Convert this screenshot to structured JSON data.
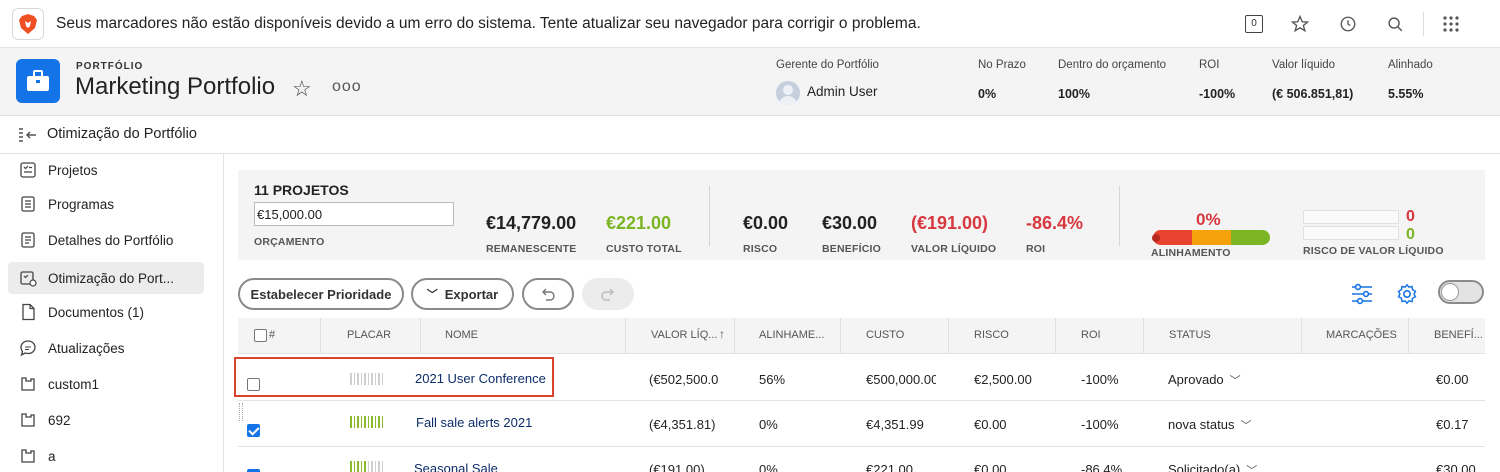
{
  "banner": {
    "message": "Seus marcadores não estão disponíveis devido a um erro do sistema. Tente atualizar seu navegador para corrigir o problema.",
    "badge_count": "0",
    "icons": [
      "brave-lion-icon",
      "tab-counter-icon",
      "star-icon",
      "history-icon",
      "search-icon",
      "grid-icon"
    ]
  },
  "portfolio": {
    "eyebrow": "PORTFÓLIO",
    "title": "Marketing Portfolio",
    "more": "ooo",
    "stats": {
      "manager_label": "Gerente do Portfólio",
      "manager_name": "Admin User",
      "on_time_label": "No Prazo",
      "on_time_value": "0%",
      "budget_label": "Dentro do orçamento",
      "budget_value": "100%",
      "roi_label": "ROI",
      "roi_value": "-100%",
      "net_label": "Valor líquido",
      "net_value": "(€ 506.851,81)",
      "aligned_label": "Alinhado",
      "aligned_value": "5.55%"
    }
  },
  "subheader": {
    "title": "Otimização do Portfólio"
  },
  "sidebar": {
    "items": [
      {
        "label": "Projetos",
        "icon": "projects-icon"
      },
      {
        "label": "Programas",
        "icon": "programs-icon"
      },
      {
        "label": "Detalhes do Portfólio",
        "icon": "details-icon"
      },
      {
        "label": "Otimização do Port...",
        "icon": "optimizer-icon",
        "active": true
      },
      {
        "label": "Documentos (1)",
        "icon": "documents-icon"
      },
      {
        "label": "Atualizações",
        "icon": "updates-icon"
      },
      {
        "label": "custom1",
        "icon": "custom-icon"
      },
      {
        "label": "692",
        "icon": "custom-icon"
      },
      {
        "label": "a",
        "icon": "custom-icon"
      }
    ]
  },
  "summary": {
    "projects_count": "11 PROJETOS",
    "budget_value": "€15,000.00",
    "budget_label": "ORÇAMENTO",
    "remaining_value": "€14,779.00",
    "remaining_label": "REMANESCENTE",
    "total_cost_value": "€221.00",
    "total_cost_label": "CUSTO TOTAL",
    "risk_value": "€0.00",
    "risk_label": "RISCO",
    "benefit_value": "€30.00",
    "benefit_label": "BENEFÍCIO",
    "net_value": "(€191.00)",
    "net_label": "VALOR LÍQUIDO",
    "roi_value": "-86.4%",
    "roi_label": "ROI",
    "alignment_value": "0%",
    "alignment_label": "ALINHAMENTO",
    "alignment_level": 0,
    "risk_net_red": "0",
    "risk_net_green": "0",
    "risk_net_label": "RISCO DE VALOR LÍQUIDO"
  },
  "toolbar": {
    "prioritize_label": "Estabelecer Prioridade",
    "export_label": "Exportar",
    "icons": [
      "filter-sliders-icon",
      "settings-gear-icon",
      "toggle-switch"
    ]
  },
  "table": {
    "columns": [
      "#",
      "PLACAR",
      "NOME",
      "VALOR LÍQ...",
      "ALINHAME...",
      "CUSTO",
      "RISCO",
      "ROI",
      "STATUS",
      "MARCAÇÕES",
      "BENEFÍ..."
    ],
    "rows": [
      {
        "checked": false,
        "score_color": "gray",
        "name": "2021 User Conference",
        "net": "(€502,500.0",
        "alignment": "56%",
        "cost": "€500,000.00",
        "risk": "€2,500.00",
        "roi": "-100%",
        "status": "Aprovado",
        "benefit": "€0.00"
      },
      {
        "checked": true,
        "score_color": "green",
        "name": "Fall sale alerts 2021",
        "net": "(€4,351.81)",
        "alignment": "0%",
        "cost": "€4,351.99",
        "risk": "€0.00",
        "roi": "-100%",
        "status": "nova status",
        "benefit": "€0.17"
      },
      {
        "checked": true,
        "score_color": "mixed",
        "name": "Seasonal Sale",
        "net": "(€191.00)",
        "alignment": "0%",
        "cost": "€221.00",
        "risk": "€0.00",
        "roi": "-86.4%",
        "status": "Solicitado(a)",
        "benefit": "€30.00"
      }
    ]
  },
  "colors": {
    "accent": "#1473e6",
    "positive": "#7cb524",
    "negative": "#d7373f",
    "highlight_box": "#d9442f"
  }
}
